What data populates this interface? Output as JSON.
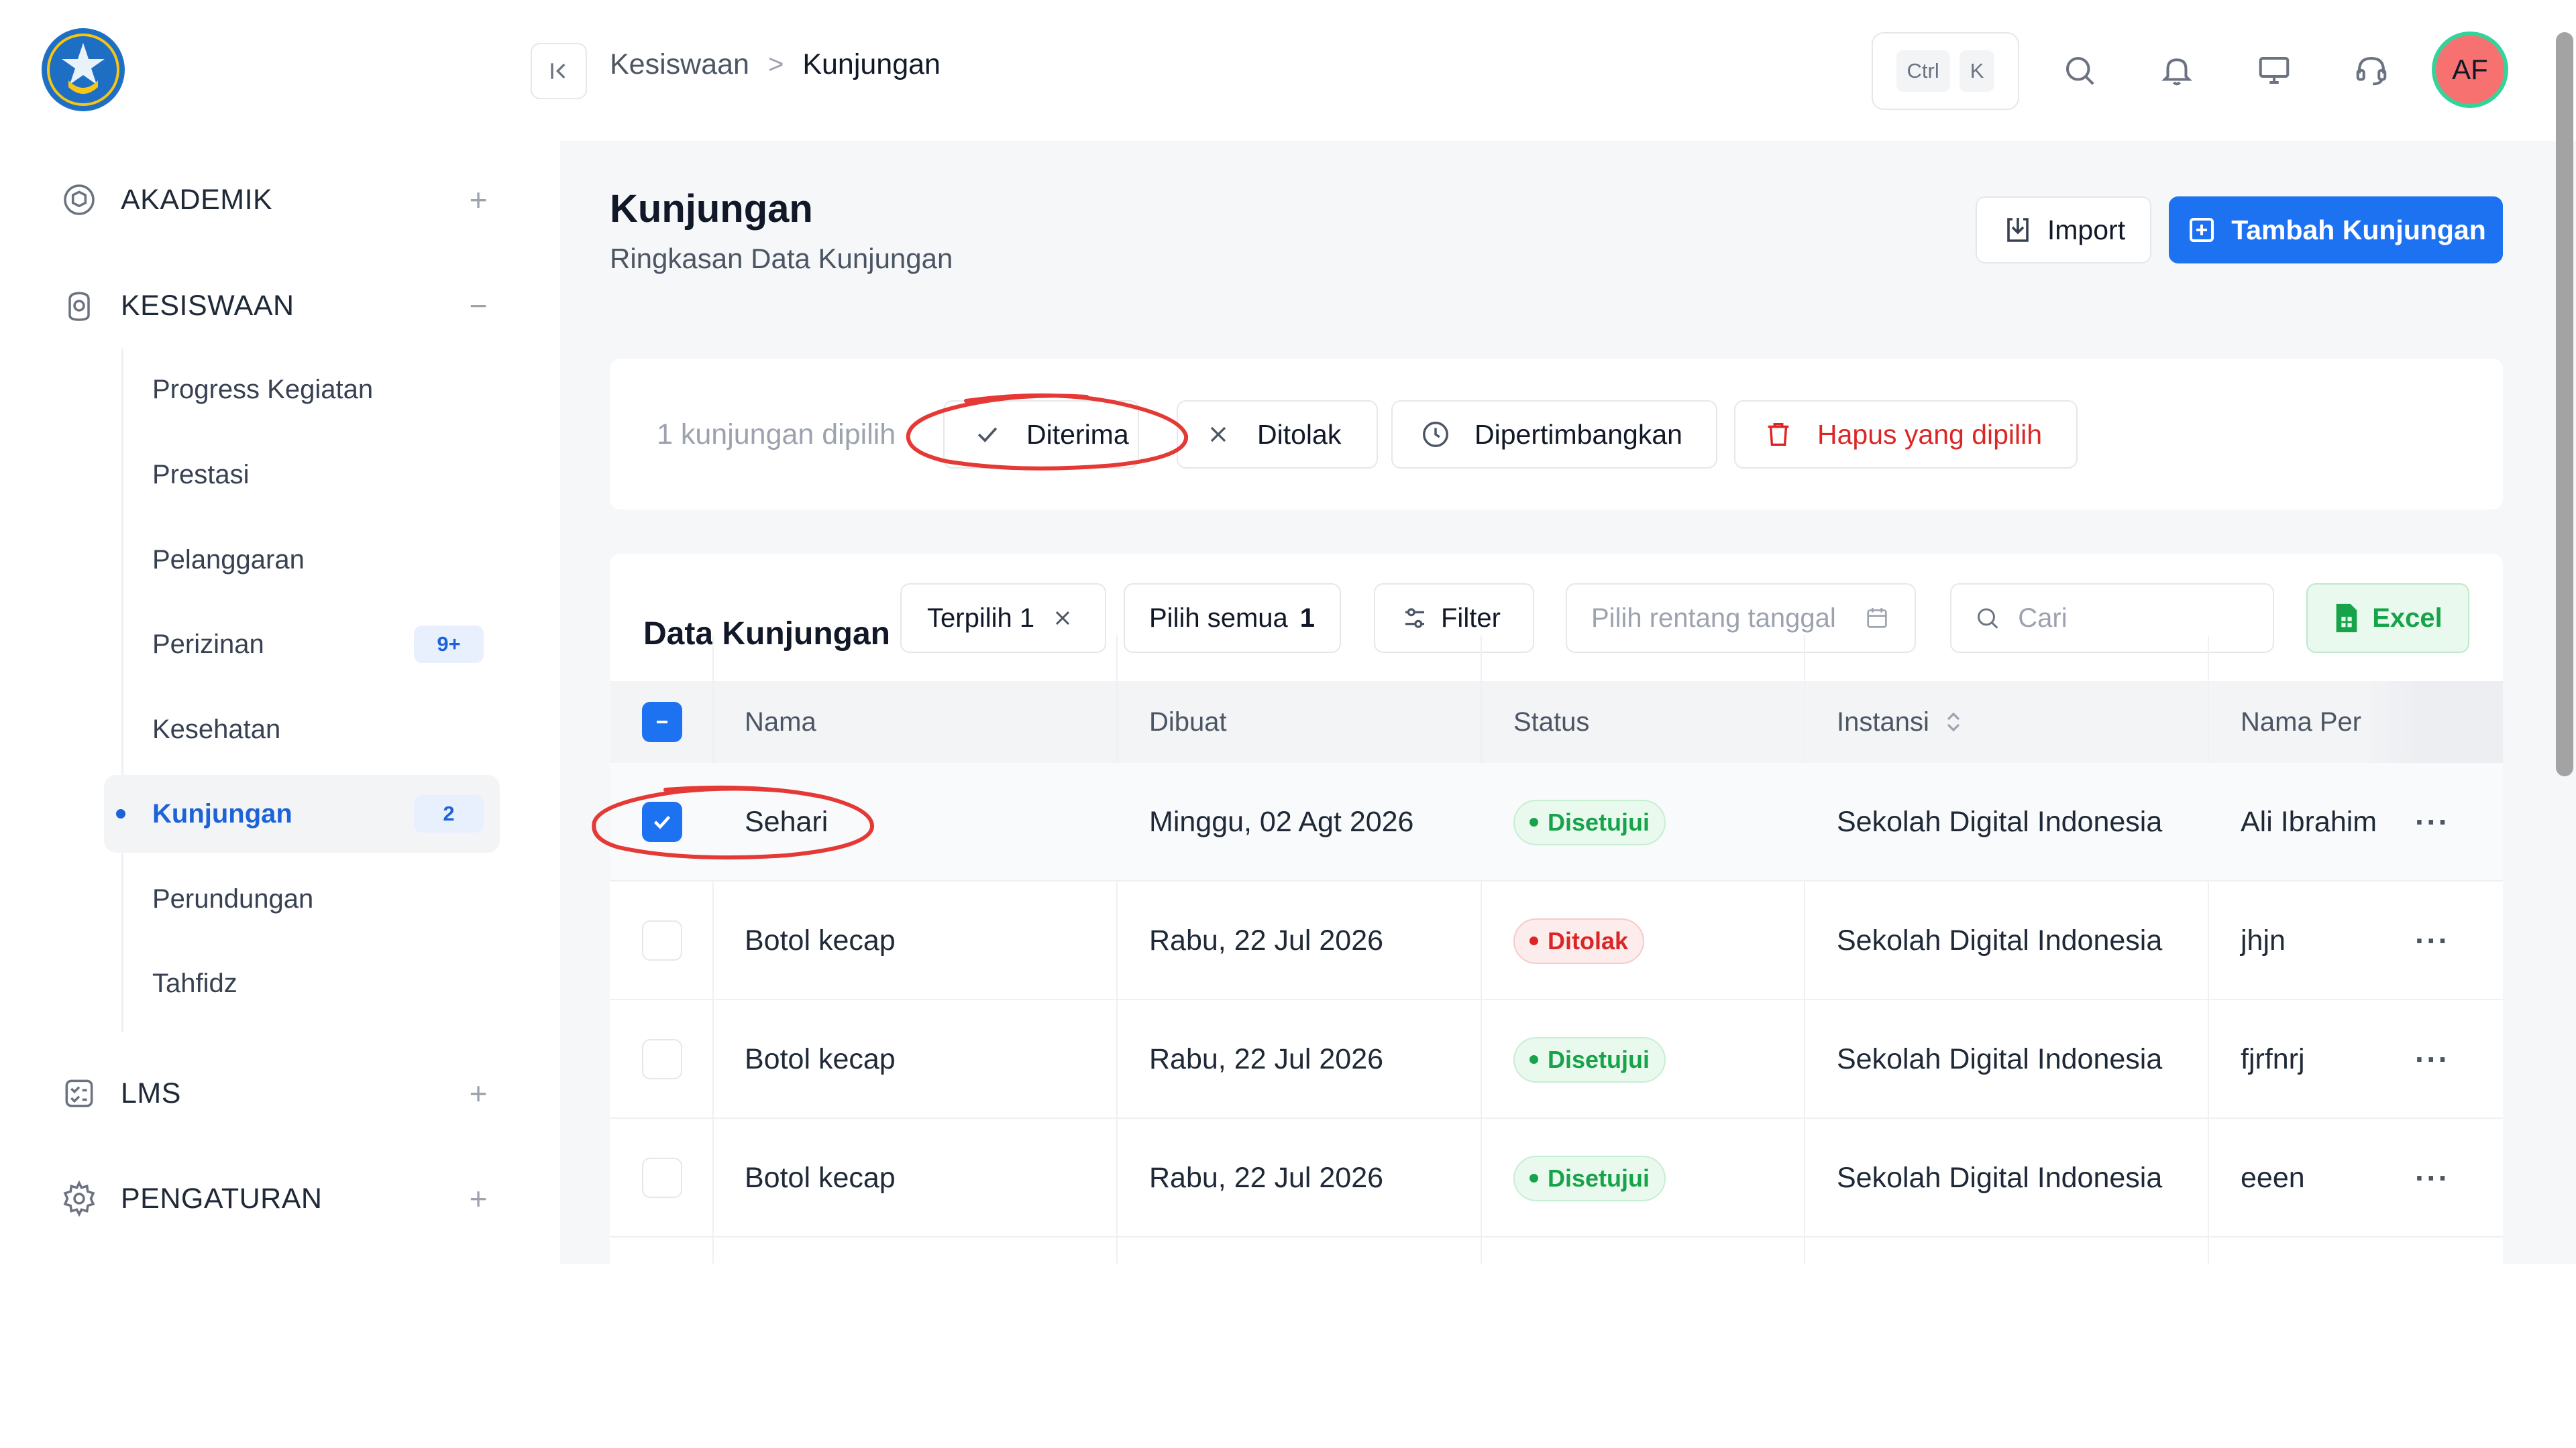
{
  "sidebar": {
    "sections": [
      {
        "label": "AKADEMIK",
        "toggle": "+"
      },
      {
        "label": "KESISWAAN",
        "toggle": "−"
      },
      {
        "label": "LMS",
        "toggle": "+"
      },
      {
        "label": "PENGATURAN",
        "toggle": "+"
      }
    ],
    "sub_items": [
      {
        "label": "Progress Kegiatan"
      },
      {
        "label": "Prestasi"
      },
      {
        "label": "Pelanggaran"
      },
      {
        "label": "Perizinan",
        "badge": "9+"
      },
      {
        "label": "Kesehatan"
      },
      {
        "label": "Kunjungan",
        "badge": "2",
        "active": true
      },
      {
        "label": "Perundungan"
      },
      {
        "label": "Tahfidz"
      }
    ]
  },
  "topbar": {
    "breadcrumb": {
      "parent": "Kesiswaan",
      "separator": ">",
      "current": "Kunjungan"
    },
    "shortcut": {
      "key1": "Ctrl",
      "key2": "K"
    },
    "icons": [
      "search-icon",
      "bell-icon",
      "monitor-icon",
      "headset-icon"
    ],
    "avatar_initials": "AF"
  },
  "page": {
    "title": "Kunjungan",
    "subtitle": "Ringkasan Data Kunjungan",
    "import_label": "Import",
    "add_label": "Tambah Kunjungan"
  },
  "bulk": {
    "selected_text": "1 kunjungan dipilih",
    "accept_label": "Diterima",
    "reject_label": "Ditolak",
    "consider_label": "Dipertimbangkan",
    "delete_label": "Hapus yang dipilih"
  },
  "table": {
    "title": "Data Kunjungan",
    "selected_chip": "Terpilih 1",
    "select_all": "Pilih semua",
    "select_all_count": "1",
    "filter_label": "Filter",
    "date_placeholder": "Pilih rentang tanggal",
    "search_placeholder": "Cari",
    "excel_label": "Excel",
    "columns": [
      "Nama",
      "Dibuat",
      "Status",
      "Instansi",
      "Nama Per"
    ],
    "rows": [
      {
        "nama": "Sehari",
        "dibuat": "Minggu, 02 Agt 2026",
        "status": "Disetujui",
        "instansi": "Sekolah Digital Indonesia",
        "nama_per": "Ali Ibrahim",
        "checked": true
      },
      {
        "nama": "Botol kecap",
        "dibuat": "Rabu, 22 Jul 2026",
        "status": "Ditolak",
        "instansi": "Sekolah Digital Indonesia",
        "nama_per": "jhjn",
        "checked": false
      },
      {
        "nama": "Botol kecap",
        "dibuat": "Rabu, 22 Jul 2026",
        "status": "Disetujui",
        "instansi": "Sekolah Digital Indonesia",
        "nama_per": "fjrfnrj",
        "checked": false
      },
      {
        "nama": "Botol kecap",
        "dibuat": "Rabu, 22 Jul 2026",
        "status": "Disetujui",
        "instansi": "Sekolah Digital Indonesia",
        "nama_per": "eeen",
        "checked": false
      }
    ]
  },
  "colors": {
    "primary": "#1d72f2",
    "approved": "#16a34a",
    "rejected": "#dc2626",
    "annotation": "#e53935"
  }
}
